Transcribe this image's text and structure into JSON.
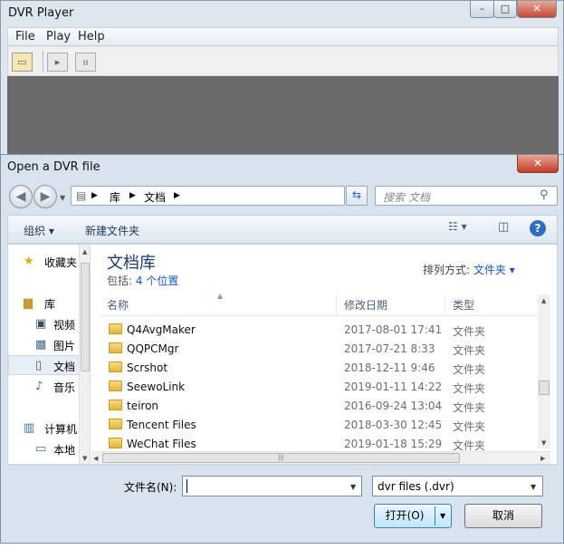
{
  "main_window": {
    "title": "DVR Player",
    "menu": [
      "File",
      "Play",
      "Help"
    ],
    "toolbar_icons": [
      "open-folder-icon",
      "play-icon",
      "pause-icon"
    ]
  },
  "dialog": {
    "title": "Open a DVR file",
    "address": {
      "root": "库",
      "folder": "文档"
    },
    "search_placeholder": "搜索 文档",
    "commands": {
      "organize": "组织",
      "new_folder": "新建文件夹"
    },
    "nav": [
      {
        "icon": "star-icon",
        "label": "收藏夹"
      },
      {
        "icon": "library-icon",
        "label": "库"
      },
      {
        "icon": "video-icon",
        "label": "视频"
      },
      {
        "icon": "picture-icon",
        "label": "图片"
      },
      {
        "icon": "document-icon",
        "label": "文档",
        "selected": true
      },
      {
        "icon": "music-icon",
        "label": "音乐"
      },
      {
        "icon": "computer-icon",
        "label": "计算机"
      },
      {
        "icon": "disk-icon",
        "label": "本地"
      }
    ],
    "library": {
      "title": "文档库",
      "includes_label": "包括:",
      "includes_value": "4 个位置"
    },
    "arrange": {
      "label": "排列方式:",
      "value": "文件夹"
    },
    "columns": {
      "name": "名称",
      "modified": "修改日期",
      "type": "类型"
    },
    "files": [
      {
        "name": "Q4AvgMaker",
        "modified": "2017-08-01 17:41",
        "type": "文件夹"
      },
      {
        "name": "QQPCMgr",
        "modified": "2017-07-21 8:33",
        "type": "文件夹"
      },
      {
        "name": "Scrshot",
        "modified": "2018-12-11 9:46",
        "type": "文件夹"
      },
      {
        "name": "SeewoLink",
        "modified": "2019-01-11 14:22",
        "type": "文件夹"
      },
      {
        "name": "teiron",
        "modified": "2016-09-24 13:04",
        "type": "文件夹"
      },
      {
        "name": "Tencent Files",
        "modified": "2018-03-30 12:45",
        "type": "文件夹"
      },
      {
        "name": "WeChat Files",
        "modified": "2019-01-18 15:29",
        "type": "文件夹"
      }
    ],
    "filename_label": "文件名(N):",
    "filename_value": "",
    "filter_value": "dvr files (.dvr)",
    "open_label": "打开(O)",
    "cancel_label": "取消"
  }
}
